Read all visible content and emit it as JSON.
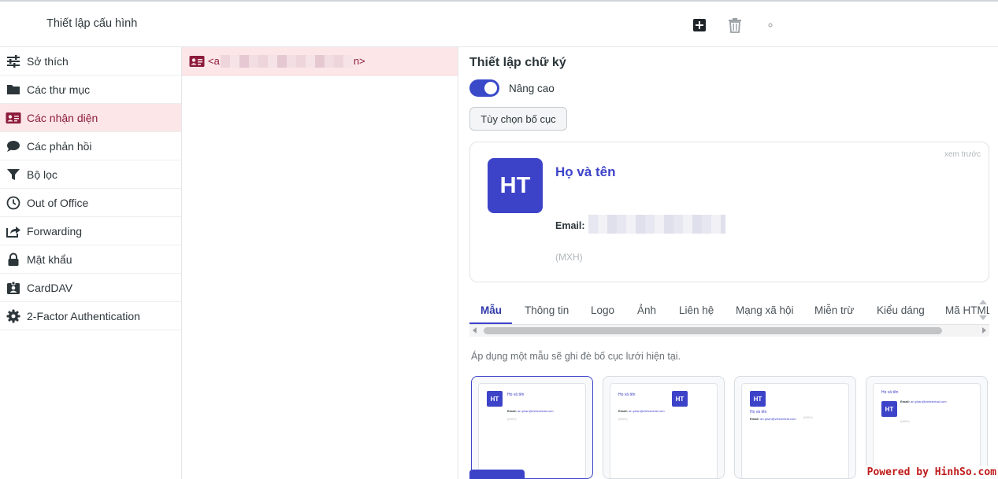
{
  "header": {
    "title": "Thiết lập cấu hình"
  },
  "toolbar": {
    "add_icon": "plus-square-icon",
    "delete_icon": "trash-icon",
    "more_icon": "small-dot-icon"
  },
  "sidebar": {
    "items": [
      {
        "label": "Sở thích",
        "icon": "sliders-icon",
        "selected": false
      },
      {
        "label": "Các thư mục",
        "icon": "folder-icon",
        "selected": false
      },
      {
        "label": "Các nhận diện",
        "icon": "id-card-icon",
        "selected": true
      },
      {
        "label": "Các phản hồi",
        "icon": "chat-bubble-icon",
        "selected": false
      },
      {
        "label": "Bộ lọc",
        "icon": "filter-icon",
        "selected": false
      },
      {
        "label": "Out of Office",
        "icon": "clock-icon",
        "selected": false
      },
      {
        "label": "Forwarding",
        "icon": "share-icon",
        "selected": false
      },
      {
        "label": "Mật khẩu",
        "icon": "lock-icon",
        "selected": false
      },
      {
        "label": "CardDAV",
        "icon": "contact-card-icon",
        "selected": false
      },
      {
        "label": "2-Factor Authentication",
        "icon": "gear-icon",
        "selected": false
      }
    ]
  },
  "identity": {
    "prefix": "<a",
    "suffix": "n>"
  },
  "signature": {
    "title": "Thiết lập chữ ký",
    "advanced_label": "Nâng cao",
    "advanced_on": true,
    "layout_button": "Tùy chọn bố cục",
    "preview": {
      "hint": "xem trước",
      "initials": "HT",
      "name": "Họ và tên",
      "email_label": "Email:",
      "social": "(MXH)"
    },
    "tabs": [
      "Mẫu",
      "Thông tin",
      "Logo",
      "Ảnh",
      "Liên hệ",
      "Mạng xã hội",
      "Miễn trừ",
      "Kiểu dáng",
      "Mã HTML"
    ],
    "active_tab": 0,
    "template_note": "Áp dụng một mẫu sẽ ghi đè bố cục lưới hiện tại.",
    "template_sample": {
      "name": "Họ và tên",
      "email_label": "Email:",
      "email": "an.phan@vietcentral.com",
      "social": "(MXH)",
      "initials": "HT"
    }
  },
  "colors": {
    "accent": "#3d43c8",
    "selected_bg": "#fde6e8",
    "selected_text": "#8c1c3c"
  },
  "watermark": "Powered by HinhSo.com"
}
